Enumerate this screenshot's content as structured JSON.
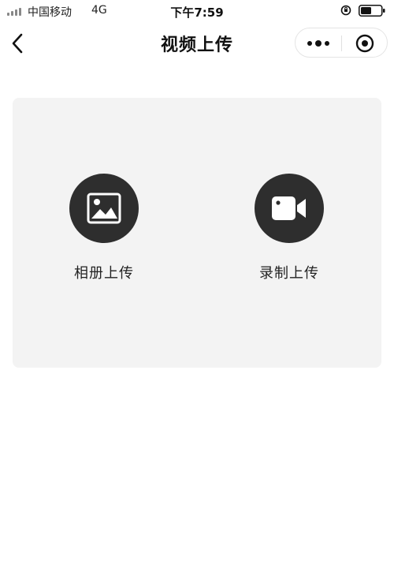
{
  "status_bar": {
    "carrier": "中国移动",
    "network": "4G",
    "time": "下午7:59"
  },
  "nav": {
    "title": "视频上传",
    "icons": [
      "back-chevron-icon",
      "more-dots-icon",
      "close-miniprogram-icon"
    ]
  },
  "options": [
    {
      "label": "相册上传",
      "icon": "image-icon"
    },
    {
      "label": "录制上传",
      "icon": "video-camera-icon"
    }
  ],
  "colors": {
    "card_background": "#f3f3f3",
    "icon_circle": "#2e2e2e",
    "text": "#222222"
  }
}
